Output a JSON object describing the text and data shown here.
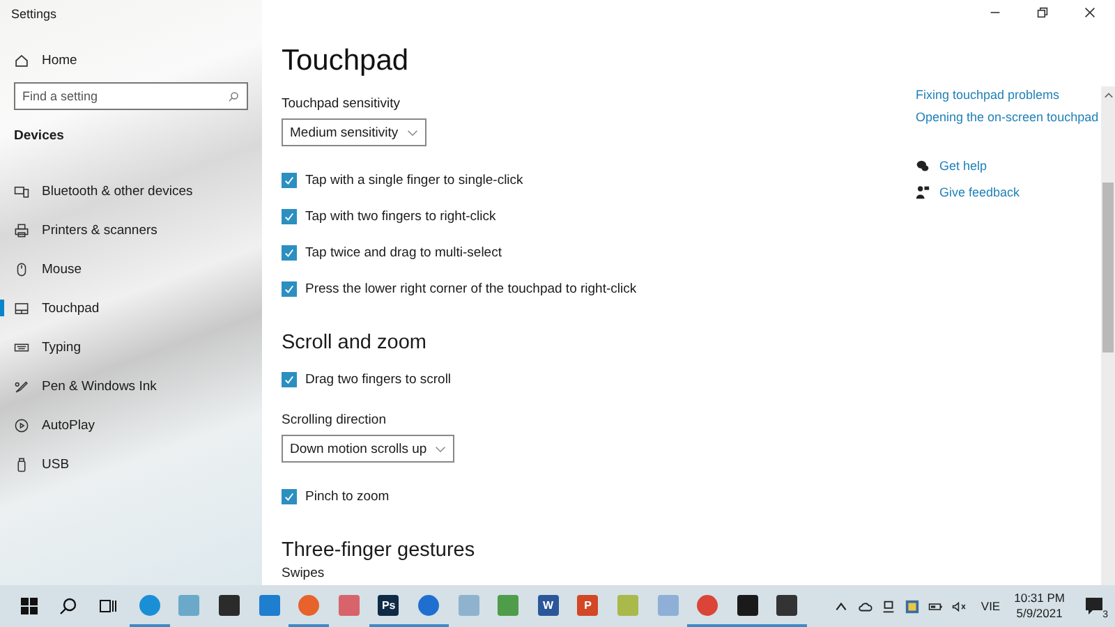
{
  "window": {
    "title": "Settings"
  },
  "sidebar": {
    "home": "Home",
    "search": {
      "placeholder": "Find a setting"
    },
    "section": "Devices",
    "items": [
      {
        "label": "Bluetooth & other devices",
        "kind": "devices",
        "selected": false
      },
      {
        "label": "Printers & scanners",
        "kind": "printer",
        "selected": false
      },
      {
        "label": "Mouse",
        "kind": "mouse",
        "selected": false
      },
      {
        "label": "Touchpad",
        "kind": "touchpad",
        "selected": true
      },
      {
        "label": "Typing",
        "kind": "keyboard",
        "selected": false
      },
      {
        "label": "Pen & Windows Ink",
        "kind": "pen",
        "selected": false
      },
      {
        "label": "AutoPlay",
        "kind": "autoplay",
        "selected": false
      },
      {
        "label": "USB",
        "kind": "usb",
        "selected": false
      }
    ]
  },
  "content": [
    {
      "kind": "title",
      "text": "Touchpad"
    },
    {
      "kind": "label",
      "text": "Touchpad sensitivity"
    },
    {
      "kind": "dropdown",
      "value": "Medium sensitivity"
    },
    {
      "kind": "checkbox",
      "text": "Tap with a single finger to single-click",
      "checked": true
    },
    {
      "kind": "checkbox",
      "text": "Tap with two fingers to right-click",
      "checked": true
    },
    {
      "kind": "checkbox",
      "text": "Tap twice and drag to multi-select",
      "checked": true
    },
    {
      "kind": "checkbox",
      "text": "Press the lower right corner of the touchpad to right-click",
      "checked": true
    },
    {
      "kind": "heading",
      "text": "Scroll and zoom"
    },
    {
      "kind": "checkbox",
      "text": "Drag two fingers to scroll",
      "checked": true
    },
    {
      "kind": "label",
      "text": "Scrolling direction"
    },
    {
      "kind": "dropdown",
      "value": "Down motion scrolls up"
    },
    {
      "kind": "checkbox",
      "text": "Pinch to zoom",
      "checked": true
    },
    {
      "kind": "heading",
      "text": "Three-finger gestures"
    },
    {
      "kind": "label",
      "text": "Swipes"
    }
  ],
  "related": {
    "links": [
      "Fixing touchpad problems",
      "Opening the on-screen touchpad"
    ],
    "help": [
      {
        "kind": "help",
        "label": "Get help"
      },
      {
        "kind": "feedback",
        "label": "Give feedback"
      }
    ]
  },
  "taskbar": {
    "apps": [
      {
        "kind": "edge",
        "running": true
      },
      {
        "kind": "basket",
        "running": false
      },
      {
        "kind": "store",
        "running": false
      },
      {
        "kind": "mail",
        "running": false
      },
      {
        "kind": "firefox",
        "running": true
      },
      {
        "kind": "network",
        "running": false
      },
      {
        "kind": "ps",
        "glyph": "Ps",
        "running": true
      },
      {
        "kind": "zalo",
        "running": true
      },
      {
        "kind": "notepad",
        "running": false
      },
      {
        "kind": "chart",
        "running": false
      },
      {
        "kind": "word",
        "glyph": "W",
        "running": false
      },
      {
        "kind": "ppt",
        "glyph": "P",
        "running": false
      },
      {
        "kind": "archive",
        "running": false
      },
      {
        "kind": "tool",
        "running": false
      },
      {
        "kind": "chrome",
        "running": true
      },
      {
        "kind": "terminal",
        "running": true
      },
      {
        "kind": "settings",
        "running": true
      }
    ],
    "language": "VIE",
    "time": "10:31 PM",
    "date": "5/9/2021",
    "notifications": "3"
  }
}
